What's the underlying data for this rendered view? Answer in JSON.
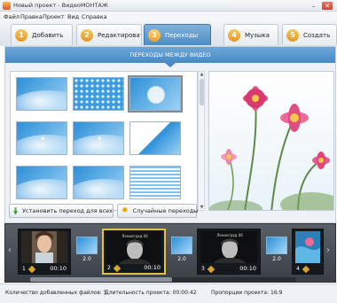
{
  "window": {
    "title": "Новый проект - ВидеоМОНТАЖ",
    "minimize_glyph": "–",
    "close_glyph": "✕"
  },
  "menu": [
    "Файл",
    "Правка",
    "Проект",
    "Вид",
    "Справка"
  ],
  "tabs": [
    {
      "number": "1",
      "label": "Добавить",
      "active": false
    },
    {
      "number": "2",
      "label": "Редактировать",
      "active": false
    },
    {
      "number": "3",
      "label": "Переходы",
      "active": true
    },
    {
      "number": "4",
      "label": "Музыка",
      "active": false
    },
    {
      "number": "5",
      "label": "Создать",
      "active": false
    }
  ],
  "panel": {
    "header": "ПЕРЕХОДЫ МЕЖДУ ВИДЕО"
  },
  "transitions": [
    {
      "style": "swirl",
      "selected": false
    },
    {
      "style": "dots",
      "selected": false
    },
    {
      "style": "circle",
      "selected": true
    },
    {
      "style": "spark",
      "selected": false
    },
    {
      "style": "spark",
      "selected": false
    },
    {
      "style": "diag",
      "selected": false
    },
    {
      "style": "swirl",
      "selected": false
    },
    {
      "style": "swirl",
      "selected": false
    },
    {
      "style": "lines",
      "selected": false
    }
  ],
  "buttons": {
    "apply_all": "Установить переход для всех",
    "random": "Случайные переходы"
  },
  "timeline": {
    "clips": [
      {
        "number": "1",
        "duration": "00:10",
        "selected": false,
        "caption": ""
      },
      {
        "number": "2",
        "duration": "00:10",
        "selected": true,
        "caption": "Ленинград 06"
      },
      {
        "number": "3",
        "duration": "00:10",
        "selected": false,
        "caption": "Ленинград 06"
      },
      {
        "number": "4",
        "duration": "",
        "selected": false,
        "caption": ""
      }
    ],
    "transitions": [
      "2.0",
      "2.0",
      "2.0"
    ]
  },
  "status": {
    "files": "Количество добавленных файлов: 5",
    "duration": "Длительность проекта: 00:00:42",
    "aspect": "Пропорции проекта: 16:9"
  },
  "colors": {
    "accent": "#4f8cc1",
    "tab_number": "#e6962a",
    "selected_clip": "#e1c14b"
  }
}
